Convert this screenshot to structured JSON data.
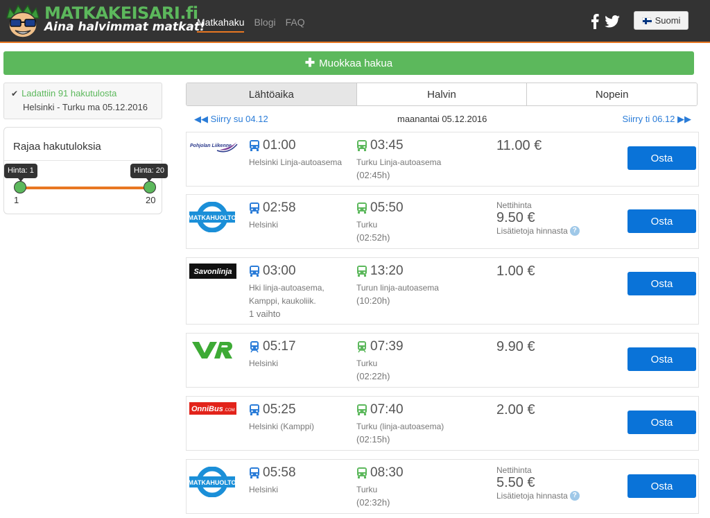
{
  "header": {
    "logo_title": "MATKAKEISARI.fi",
    "logo_subtitle": "Aina halvimmat matkat!",
    "nav": [
      {
        "label": "Matkahaku",
        "active": true
      },
      {
        "label": "Blogi",
        "active": false
      },
      {
        "label": "FAQ",
        "active": false
      }
    ],
    "language_label": "Suomi",
    "accent_color": "#e87722",
    "brand_green": "#5cb85c"
  },
  "edit_search": {
    "label": "Muokkaa hakua"
  },
  "status": {
    "loaded_text": "Ladattiin 91 hakutulosta",
    "route_text": "Helsinki - Turku ma 05.12.2016"
  },
  "filter": {
    "title": "Rajaa hakutuloksia",
    "price_min": 1,
    "price_max": 20,
    "tooltip_min": "Hinta: 1",
    "tooltip_max": "Hinta: 20",
    "label_min": "1",
    "label_max": "20"
  },
  "sort_tabs": [
    {
      "label": "Lähtöaika",
      "active": true
    },
    {
      "label": "Halvin",
      "active": false
    },
    {
      "label": "Nopein",
      "active": false
    }
  ],
  "day_nav": {
    "prev_label": "Siirry su 04.12",
    "current_label": "maanantai 05.12.2016",
    "next_label": "Siirry ti 06.12"
  },
  "results": [
    {
      "operator": "Pohjolan Liikenne",
      "mode": "bus",
      "dep_time": "01:00",
      "dep_place": "Helsinki Linja-autoasema",
      "arr_time": "03:45",
      "arr_place": "Turku Linja-autoasema",
      "duration": "(02:45h)",
      "price_note": "",
      "price": "11.00 €",
      "price_info": "",
      "buy_label": "Osta"
    },
    {
      "operator": "MATKAHUOLTO",
      "mode": "bus",
      "dep_time": "02:58",
      "dep_place": "Helsinki",
      "arr_time": "05:50",
      "arr_place": "Turku",
      "duration": "(02:52h)",
      "price_note": "Nettihinta",
      "price": "9.50 €",
      "price_info": "Lisätietoja hinnasta",
      "buy_label": "Osta"
    },
    {
      "operator": "Savonlinja",
      "mode": "bus",
      "dep_time": "03:00",
      "dep_place_lines": [
        "Hki linja-autoasema,",
        "Kamppi, kaukoliik."
      ],
      "transfer": "1 vaihto",
      "arr_time": "13:20",
      "arr_place": "Turun linja-autoasema",
      "duration": "(10:20h)",
      "price_note": "",
      "price": "1.00 €",
      "price_info": "",
      "buy_label": "Osta"
    },
    {
      "operator": "VR",
      "mode": "train",
      "dep_time": "05:17",
      "dep_place": "Helsinki",
      "arr_time": "07:39",
      "arr_place": "Turku",
      "duration": "(02:22h)",
      "price_note": "",
      "price": "9.90 €",
      "price_info": "",
      "buy_label": "Osta"
    },
    {
      "operator": "OnniBus.com",
      "mode": "bus",
      "dep_time": "05:25",
      "dep_place": "Helsinki (Kamppi)",
      "arr_time": "07:40",
      "arr_place": "Turku (linja-autoasema)",
      "duration": "(02:15h)",
      "price_note": "",
      "price": "2.00 €",
      "price_info": "",
      "buy_label": "Osta"
    },
    {
      "operator": "MATKAHUOLTO",
      "mode": "bus",
      "dep_time": "05:58",
      "dep_place": "Helsinki",
      "arr_time": "08:30",
      "arr_place": "Turku",
      "duration": "(02:32h)",
      "price_note": "Nettihinta",
      "price": "5.50 €",
      "price_info": "Lisätietoja hinnasta",
      "buy_label": "Osta"
    }
  ]
}
